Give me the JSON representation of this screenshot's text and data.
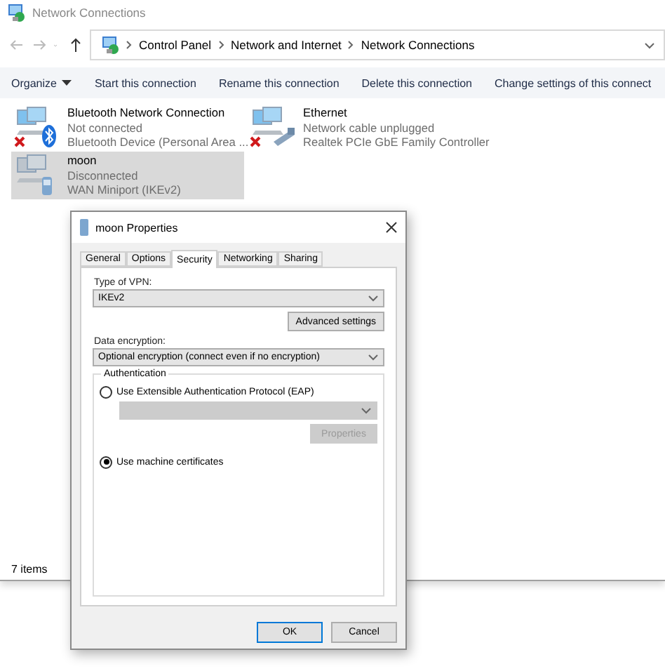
{
  "window": {
    "title": "Network Connections"
  },
  "address": {
    "path": [
      "Control Panel",
      "Network and Internet",
      "Network Connections"
    ]
  },
  "toolbar": [
    {
      "label": "Organize",
      "kind": "menu"
    },
    {
      "label": "Start this connection",
      "kind": "action"
    },
    {
      "label": "Rename this connection",
      "kind": "action"
    },
    {
      "label": "Delete this connection",
      "kind": "action"
    },
    {
      "label": "Change settings of this connect",
      "kind": "action"
    }
  ],
  "connections": [
    {
      "name": "Bluetooth Network Connection",
      "status": "Not connected",
      "device": "Bluetooth Device (Personal Area ...",
      "kind": "bluetooth",
      "error": true,
      "selected": false
    },
    {
      "name": "Ethernet",
      "status": "Network cable unplugged",
      "device": "Realtek PCIe GbE Family Controller",
      "kind": "ethernet",
      "error": true,
      "selected": false
    },
    {
      "name": "moon",
      "status": "Disconnected",
      "device": "WAN Miniport (IKEv2)",
      "kind": "vpn",
      "error": false,
      "selected": true
    }
  ],
  "status_bar": "7 items",
  "dialog": {
    "title": "moon Properties",
    "tabs": [
      {
        "label": "General",
        "selected": false
      },
      {
        "label": "Options",
        "selected": false
      },
      {
        "label": "Security",
        "selected": true
      },
      {
        "label": "Networking",
        "selected": false
      },
      {
        "label": "Sharing",
        "selected": false
      }
    ],
    "vpn_type": {
      "label": "Type of VPN:",
      "value": "IKEv2"
    },
    "advanced_button": "Advanced settings",
    "encryption": {
      "label": "Data encryption:",
      "value": "Optional encryption (connect even if no encryption)"
    },
    "authentication": {
      "title": "Authentication",
      "options": [
        {
          "label": "Use Extensible Authentication Protocol (EAP)",
          "selected": false
        },
        {
          "label": "Use machine certificates",
          "selected": true
        }
      ],
      "eap_properties": {
        "label": "Properties",
        "disabled": true
      }
    },
    "buttons": [
      {
        "label": "OK",
        "default": true
      },
      {
        "label": "Cancel",
        "default": false
      }
    ]
  }
}
